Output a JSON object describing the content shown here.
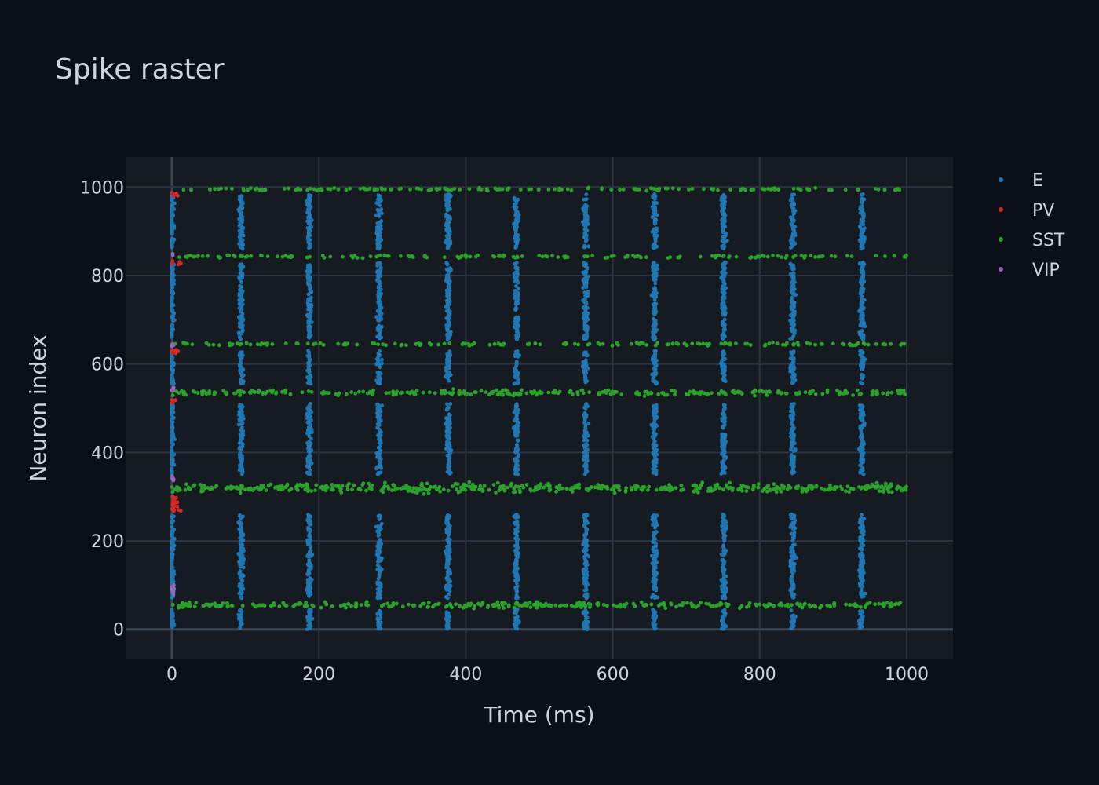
{
  "chart_data": {
    "type": "scatter",
    "title": "Spike raster",
    "xlabel": "Time (ms)",
    "ylabel": "Neuron index",
    "xlim": [
      -63,
      1063
    ],
    "ylim": [
      -68,
      1068
    ],
    "x_ticks": [
      0,
      200,
      400,
      600,
      800,
      1000
    ],
    "y_ticks": [
      0,
      200,
      400,
      600,
      800,
      1000
    ],
    "grid": true,
    "legend_position": "top-right",
    "colors": {
      "background": "#0b0f17",
      "plot_background": "#161b22",
      "grid": "#2b3440",
      "zero_line": "#3a4452"
    },
    "series": [
      {
        "name": "E",
        "color": "#1f77b4",
        "pattern": "periodic bursts every ~94 ms within E neuron blocks",
        "burst_times_ms": [
          0,
          94,
          187,
          282,
          376,
          469,
          563,
          657,
          751,
          845,
          939
        ],
        "neuron_ranges": [
          [
            0,
            45
          ],
          [
            70,
            260
          ],
          [
            350,
            510
          ],
          [
            555,
            630
          ],
          [
            655,
            830
          ],
          [
            860,
            985
          ]
        ]
      },
      {
        "name": "PV",
        "color": "#d62728",
        "pattern": "brief activity near t = 0",
        "time_range_ms": [
          0,
          15
        ],
        "neuron_ranges": [
          [
            265,
            305
          ],
          [
            510,
            520
          ],
          [
            620,
            635
          ],
          [
            825,
            835
          ],
          [
            980,
            990
          ]
        ]
      },
      {
        "name": "SST",
        "color": "#2ca02c",
        "pattern": "tonic firing bands across the whole recording",
        "time_range_ms": [
          0,
          1000
        ],
        "neuron_bands": [
          55,
          320,
          535,
          645,
          843,
          995
        ]
      },
      {
        "name": "VIP",
        "color": "#9467bd",
        "pattern": "brief activity near t = 0",
        "time_range_ms": [
          0,
          3
        ],
        "neuron_ranges": [
          [
            75,
            105
          ],
          [
            335,
            350
          ],
          [
            540,
            550
          ],
          [
            640,
            648
          ],
          [
            845,
            850
          ]
        ]
      }
    ]
  }
}
